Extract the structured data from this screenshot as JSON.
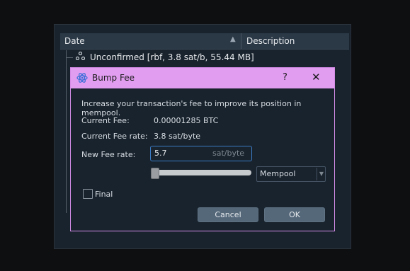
{
  "background_window": {
    "columns": {
      "date": "Date",
      "description": "Description"
    },
    "sort_indicator": "▲",
    "row": {
      "icon": "group-icon",
      "label": "Unconfirmed [rbf, 3.8 sat/b, 55.44 MB]"
    }
  },
  "dialog": {
    "title": "Bump Fee",
    "help": "?",
    "close": "✕",
    "intro": "Increase your transaction's fee to improve its position in mempool.",
    "current_fee_label": "Current Fee:",
    "current_fee_value": "0.00001285 BTC",
    "current_rate_label": "Current Fee rate:",
    "current_rate_value": "3.8 sat/byte",
    "new_rate_label": "New Fee rate:",
    "new_rate_value": "5.7",
    "new_rate_unit": "sat/byte",
    "slider_level": 0.0,
    "method_select": "Mempool",
    "final_label": "Final",
    "final_checked": false,
    "cancel_label": "Cancel",
    "ok_label": "OK"
  },
  "colors": {
    "titlebar": "#e19ef0",
    "dialog_border": "#d48ce8",
    "input_focus": "#3b7bc4",
    "button": "#54687a"
  }
}
